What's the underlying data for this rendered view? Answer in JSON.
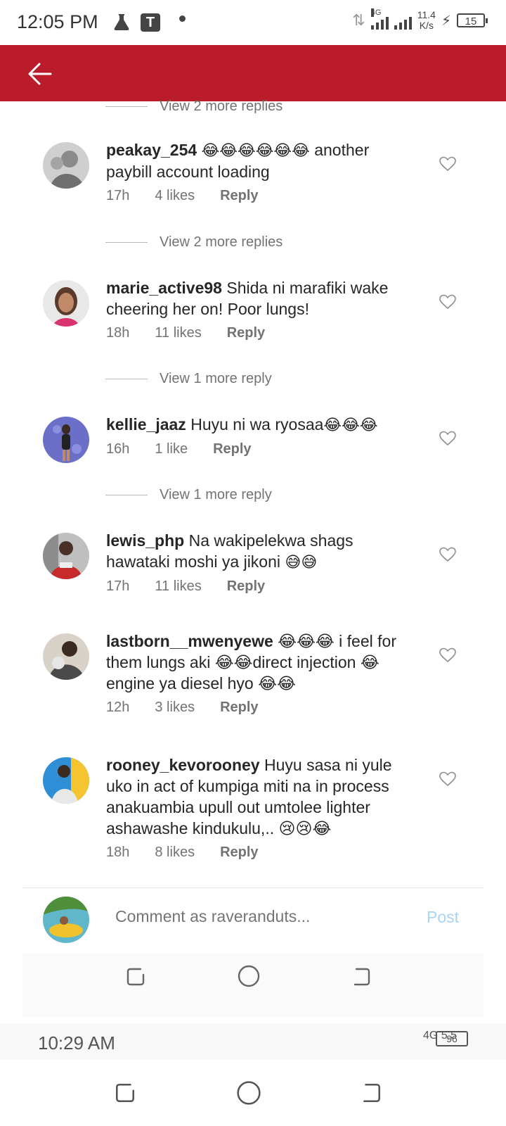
{
  "status_bar": {
    "time": "12:05 PM",
    "t_badge": "T",
    "network": "4G",
    "speed_value": "11.4",
    "speed_unit": "K/s",
    "battery": "15"
  },
  "header": {
    "back_icon": "back-arrow-icon"
  },
  "view_replies": [
    "View 2 more replies",
    "View 2 more replies",
    "View 1 more reply",
    "View 1 more reply"
  ],
  "comments": [
    {
      "username": "peakay_254",
      "emojis_pre": "😂😂😂😂😂😂",
      "text": " another paybill account loading",
      "emojis_post": "",
      "time": "17h",
      "likes": "4 likes",
      "reply": "Reply"
    },
    {
      "username": "marie_active98",
      "emojis_pre": "",
      "text": " Shida ni marafiki wake cheering her on! Poor lungs!",
      "emojis_post": "",
      "time": "18h",
      "likes": "11 likes",
      "reply": "Reply"
    },
    {
      "username": "kellie_jaaz",
      "emojis_pre": "",
      "text": " Huyu  ni wa ryosaa",
      "emojis_post": "😂😂😂",
      "time": "16h",
      "likes": "1 like",
      "reply": "Reply"
    },
    {
      "username": "lewis_php",
      "emojis_pre": "",
      "text": " Na wakipelekwa shags hawataki moshi ya jikoni ",
      "emojis_post": "😅😅",
      "time": "17h",
      "likes": "11 likes",
      "reply": "Reply"
    },
    {
      "username": "lastborn__mwenyewe",
      "emojis_pre": "",
      "text": " 😂😂😂 i feel for them lungs aki 😂😂direct injection 😂 engine ya diesel hyo 😂😂",
      "emojis_post": "",
      "time": "12h",
      "likes": "3 likes",
      "reply": "Reply"
    },
    {
      "username": "rooney_kevorooney",
      "emojis_pre": "",
      "text": " Huyu sasa ni yule uko in act of kumpiga miti na in process anakuambia upull out umtolee lighter ashawashe kindukulu,.. 😢😢😂",
      "emojis_post": "",
      "time": "18h",
      "likes": "8 likes",
      "reply": "Reply"
    }
  ],
  "composer": {
    "placeholder": "Comment as raveranduts...",
    "post_label": "Post"
  },
  "ghost_status": {
    "time": "10:29 AM",
    "battery": "96",
    "network": "4G",
    "speed": "5.5"
  },
  "colors": {
    "header": "#bb1c2b",
    "post": "#a8d4f5",
    "meta": "#737373"
  }
}
